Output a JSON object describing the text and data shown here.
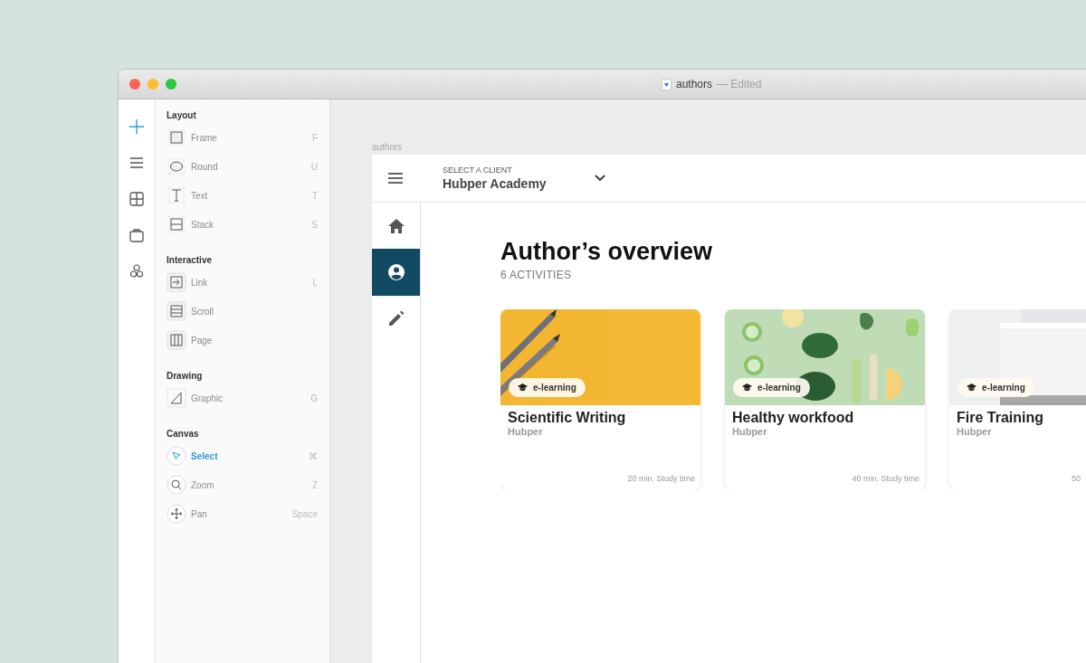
{
  "window": {
    "title": "authors",
    "status": "— Edited"
  },
  "rail": [
    {
      "kind": "plus",
      "selected": true
    },
    {
      "kind": "menu",
      "selected": false
    },
    {
      "kind": "grid",
      "selected": false
    },
    {
      "kind": "bag",
      "selected": false
    },
    {
      "kind": "circles",
      "selected": false
    }
  ],
  "panel": {
    "sections": [
      {
        "title": "Layout",
        "items": [
          {
            "kind": "frame",
            "label": "Frame",
            "shortcut": "F",
            "selected": false
          },
          {
            "kind": "round",
            "label": "Round",
            "shortcut": "U",
            "selected": false
          },
          {
            "kind": "text",
            "label": "Text",
            "shortcut": "T",
            "selected": false
          },
          {
            "kind": "stack",
            "label": "Stack",
            "shortcut": "S",
            "selected": false
          }
        ]
      },
      {
        "title": "Interactive",
        "items": [
          {
            "kind": "link",
            "label": "Link",
            "shortcut": "L",
            "selected": false
          },
          {
            "kind": "scroll",
            "label": "Scroll",
            "selected": false
          },
          {
            "kind": "page",
            "label": "Page",
            "selected": false
          }
        ]
      },
      {
        "title": "Drawing",
        "items": [
          {
            "kind": "graphic",
            "label": "Graphic",
            "shortcut": "G",
            "selected": false
          }
        ]
      },
      {
        "title": "Canvas",
        "items": [
          {
            "kind": "select",
            "label": "Select",
            "shortcut": "⌘",
            "selected": true
          },
          {
            "kind": "zoom",
            "label": "Zoom",
            "shortcut": "Z",
            "selected": false
          },
          {
            "kind": "pan",
            "label": "Pan",
            "shortcut": "Space",
            "selected": false
          }
        ]
      }
    ]
  },
  "canvas": {
    "frame_label": "authors"
  },
  "app": {
    "client_label": "SELECT A CLIENT",
    "client": "Hubper Academy",
    "nav": [
      {
        "kind": "home",
        "selected": false
      },
      {
        "kind": "person",
        "selected": true
      },
      {
        "kind": "pencil",
        "selected": false
      }
    ],
    "title": "Author’s overview",
    "subtitle": "6 ACTIVITIES",
    "cards": [
      {
        "badge": "e-learning",
        "title": "Scientific Writing",
        "author": "Hubper",
        "time": "20 min. Study time"
      },
      {
        "badge": "e-learning",
        "title": "Healthy workfood",
        "author": "Hubper",
        "time": "40 min. Study time"
      },
      {
        "badge": "e-learning",
        "title": "Fire Training",
        "author": "Hubper",
        "time": "50"
      }
    ]
  }
}
